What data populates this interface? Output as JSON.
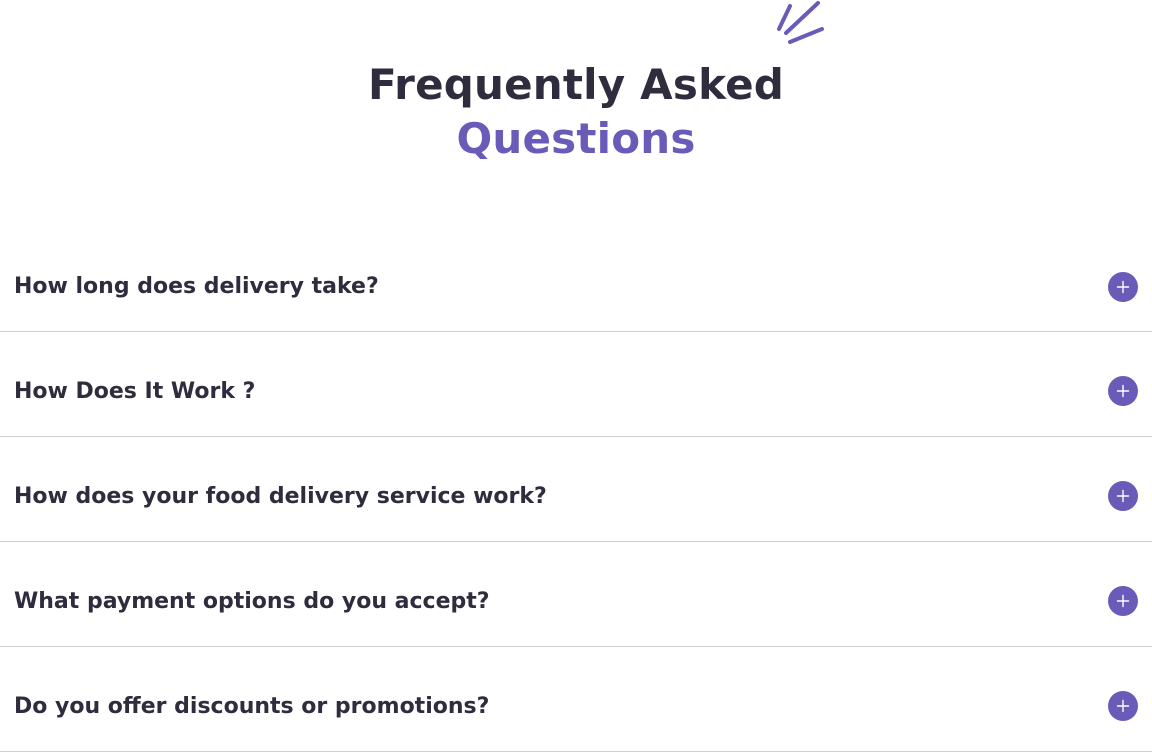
{
  "heading": {
    "line1": "Frequently Asked",
    "line2": "Questions"
  },
  "colors": {
    "text_dark": "#2f2c3d",
    "accent": "#6b5bb8",
    "divider": "#cfcfd4"
  },
  "icons": {
    "decoration": "sparkle-lines-icon",
    "toggle": "plus-icon"
  },
  "faq": {
    "items": [
      {
        "question": "How long does delivery take?"
      },
      {
        "question": "How Does It Work ?"
      },
      {
        "question": "How does your food delivery service work?"
      },
      {
        "question": "What payment options do you accept?"
      },
      {
        "question": "Do you offer discounts or promotions?"
      }
    ]
  }
}
